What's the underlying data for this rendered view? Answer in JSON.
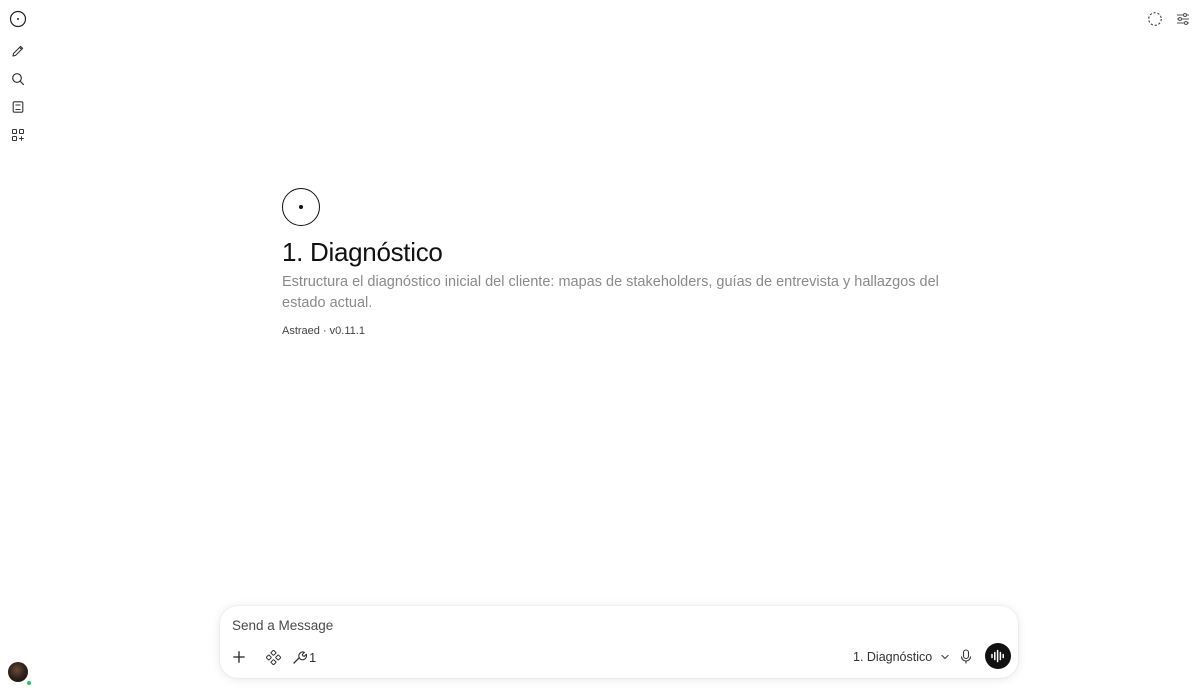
{
  "sidebar": {
    "items": [
      {
        "icon": "logo-icon"
      },
      {
        "icon": "pencil-icon"
      },
      {
        "icon": "search-icon"
      },
      {
        "icon": "notes-icon"
      },
      {
        "icon": "workspace-icon"
      }
    ]
  },
  "topbar": {
    "icons": [
      "temporary-chat-icon",
      "settings-sliders-icon"
    ]
  },
  "model": {
    "title": "1. Diagnóstico",
    "description": "Estructura el diagnóstico inicial del cliente: mapas de stakeholders, guías de entrevista y hallazgos del estado actual.",
    "meta": "Astraed · v0.11.1"
  },
  "composer": {
    "placeholder": "Send a Message",
    "tools_count": "1",
    "selected_model": "1. Diagnóstico"
  },
  "colors": {
    "accent": "#111111",
    "muted_text": "#8a8a8a",
    "online": "#22c55e"
  }
}
